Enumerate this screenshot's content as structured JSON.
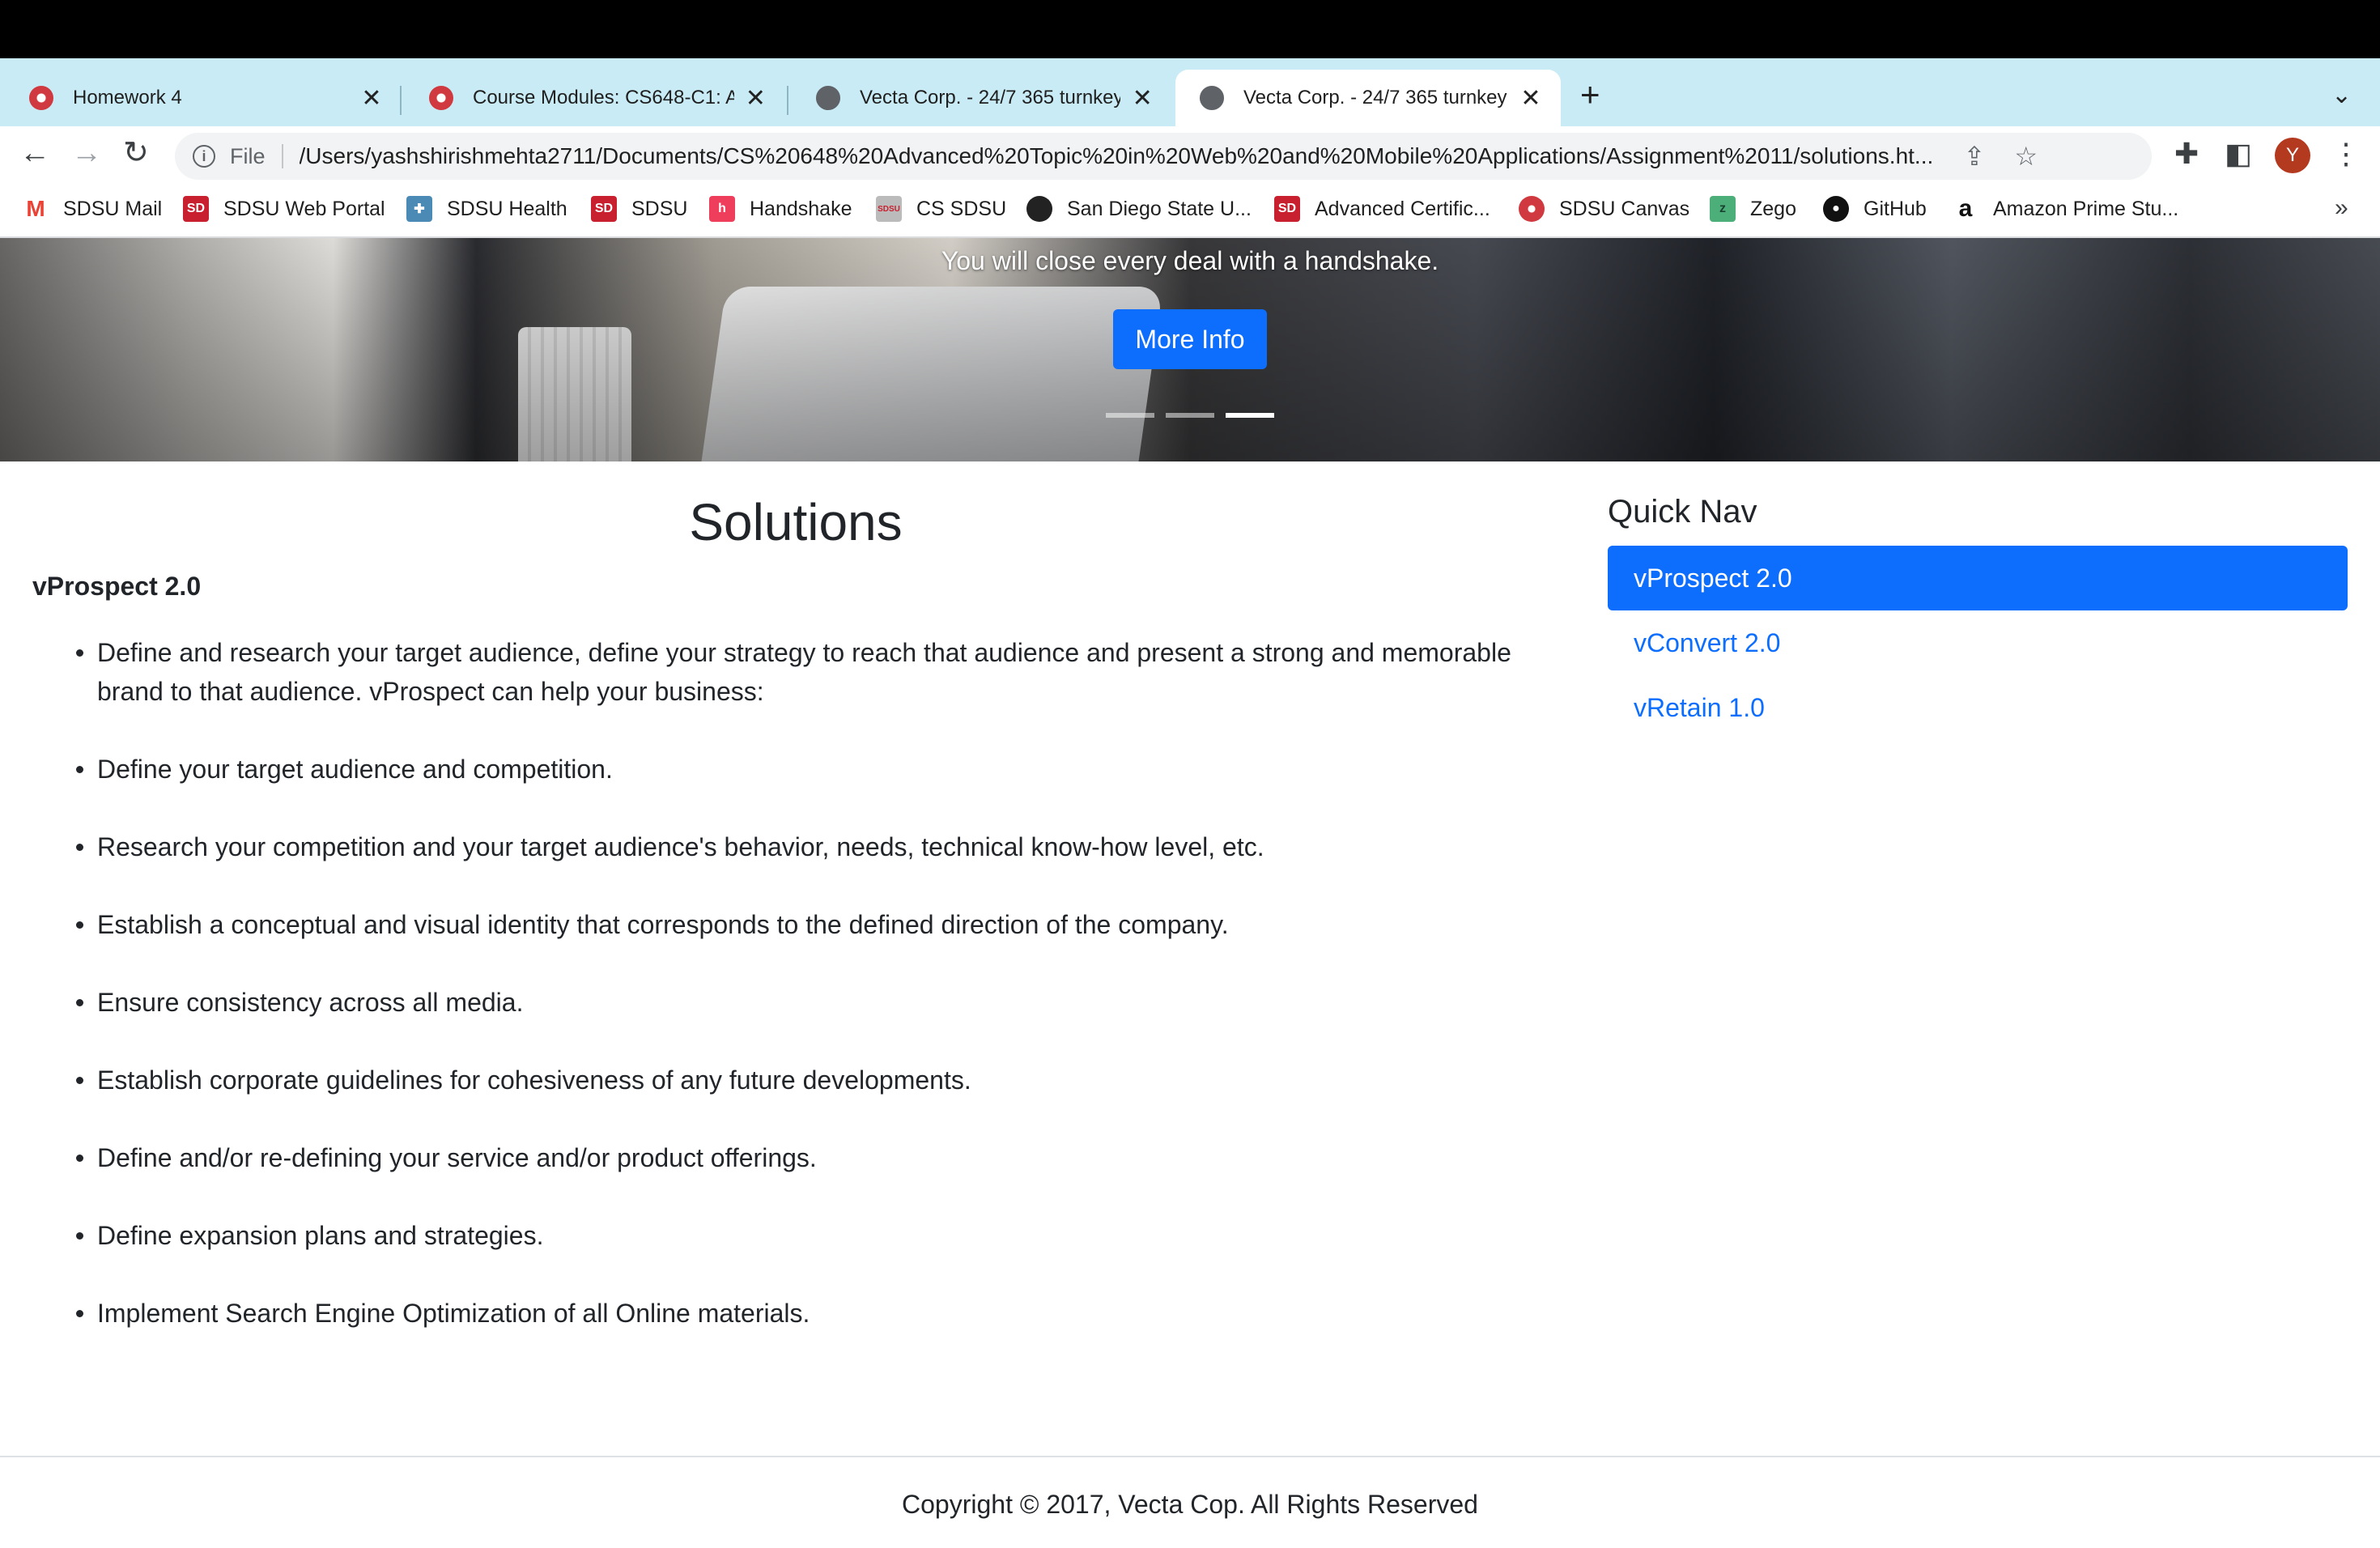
{
  "browser": {
    "tabs": [
      {
        "title": "Homework 4",
        "favicon": "canvas-icon",
        "active": false
      },
      {
        "title": "Course Modules: CS648-C1: A",
        "favicon": "canvas-icon",
        "active": false
      },
      {
        "title": "Vecta Corp. - 24/7 365 turnkey",
        "favicon": "globe-icon",
        "active": false
      },
      {
        "title": "Vecta Corp. - 24/7 365 turnkey",
        "favicon": "globe-icon",
        "active": true
      }
    ],
    "address": {
      "scheme_label": "File",
      "url": "/Users/yashshirishmehta2711/Documents/CS%20648%20Advanced%20Topic%20in%20Web%20and%20Mobile%20Applications/Assignment%2011/solutions.ht..."
    },
    "profile_initial": "Y",
    "bookmarks": [
      {
        "label": "SDSU Mail",
        "icon": "gmail-icon"
      },
      {
        "label": "SDSU Web Portal",
        "icon": "sdsu-icon"
      },
      {
        "label": "SDSU Health",
        "icon": "health-icon"
      },
      {
        "label": "SDSU",
        "icon": "sdsu-icon"
      },
      {
        "label": "Handshake",
        "icon": "handshake-icon"
      },
      {
        "label": "CS SDSU",
        "icon": "cs-sdsu-icon"
      },
      {
        "label": "San Diego State U...",
        "icon": "globe-icon"
      },
      {
        "label": "Advanced Certific...",
        "icon": "sdsu-icon"
      },
      {
        "label": "SDSU Canvas",
        "icon": "canvas-icon"
      },
      {
        "label": "Zego",
        "icon": "zego-icon"
      },
      {
        "label": "GitHub",
        "icon": "github-icon"
      },
      {
        "label": "Amazon Prime Stu...",
        "icon": "amazon-icon"
      }
    ]
  },
  "hero": {
    "caption": "You will close every deal with a handshake.",
    "button_label": "More Info",
    "slide_count": 3,
    "active_slide": 3
  },
  "content": {
    "title": "Solutions",
    "subheading": "vProspect 2.0",
    "items": [
      "Define and research your target audience, define your strategy to reach that audience and present a strong and memorable brand to that audience. vProspect can help your business:",
      "Define your target audience and competition.",
      "Research your competition and your target audience's behavior, needs, technical know-how level, etc.",
      "Establish a conceptual and visual identity that corresponds to the defined direction of the company.",
      "Ensure consistency across all media.",
      "Establish corporate guidelines for cohesiveness of any future developments.",
      "Define and/or re-defining your service and/or product offerings.",
      "Define expansion plans and strategies.",
      "Implement Search Engine Optimization of all Online materials."
    ]
  },
  "quick_nav": {
    "title": "Quick Nav",
    "items": [
      {
        "label": "vProspect 2.0",
        "active": true
      },
      {
        "label": "vConvert 2.0",
        "active": false
      },
      {
        "label": "vRetain 1.0",
        "active": false
      }
    ]
  },
  "footer": {
    "text": "Copyright © 2017, Vecta Cop. All Rights Reserved"
  },
  "colors": {
    "primary": "#0d6efd",
    "tabstrip": "#c9ebf5",
    "text": "#212529"
  }
}
